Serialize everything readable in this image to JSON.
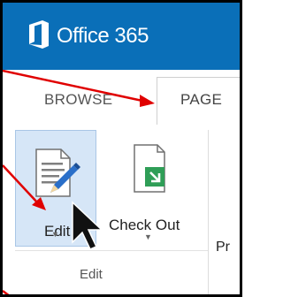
{
  "suite": {
    "brand": "Office 365",
    "logo_icon": "office-logo-icon",
    "bar_color": "#0a6fb8"
  },
  "tabs": [
    {
      "label": "BROWSE",
      "selected": false
    },
    {
      "label": "PAGE",
      "selected": true
    }
  ],
  "ribbon": {
    "buttons": [
      {
        "label": "Edit",
        "icon": "edit-page-icon",
        "highlighted": true
      },
      {
        "label": "Check Out",
        "icon": "check-out-icon"
      }
    ],
    "group_label": "Edit",
    "partial_label": "Pr"
  },
  "annotation": {
    "arrow_color": "#e00000",
    "cursor": "mouse-pointer-icon"
  }
}
